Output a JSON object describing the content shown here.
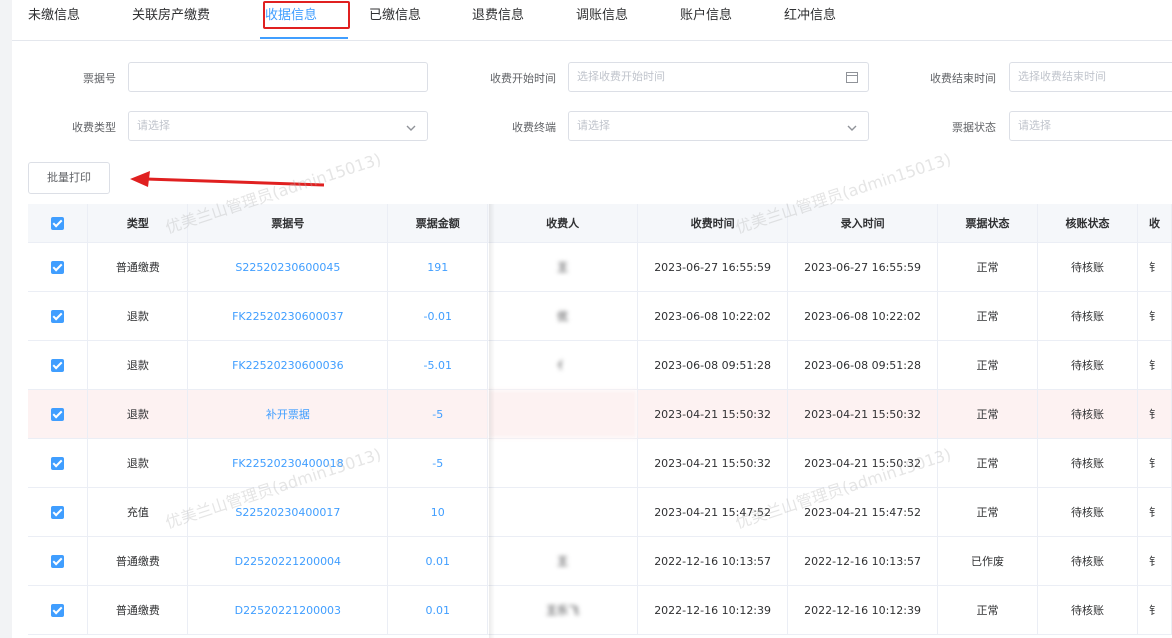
{
  "tabs": [
    {
      "label": "未缴信息"
    },
    {
      "label": "关联房产缴费"
    },
    {
      "label": "收据信息"
    },
    {
      "label": "已缴信息"
    },
    {
      "label": "退费信息"
    },
    {
      "label": "调账信息"
    },
    {
      "label": "账户信息"
    },
    {
      "label": "红冲信息"
    }
  ],
  "active_tab": "收据信息",
  "filters": {
    "receipt_no": {
      "label": "票据号",
      "value": "",
      "placeholder": ""
    },
    "start_time": {
      "label": "收费开始时间",
      "placeholder": "选择收费开始时间"
    },
    "end_time": {
      "label": "收费结束时间",
      "placeholder": "选择收费结束时间"
    },
    "fee_type": {
      "label": "收费类型",
      "placeholder": "请选择"
    },
    "terminal": {
      "label": "收费终端",
      "placeholder": "请选择"
    },
    "receipt_status": {
      "label": "票据状态",
      "placeholder": "请选择"
    }
  },
  "batch_print_label": "批量打印",
  "watermark": "优美兰山管理员(admin15013)",
  "table": {
    "columns": [
      "类型",
      "票据号",
      "票据金额",
      "收费人",
      "收费时间",
      "录入时间",
      "票据状态",
      "核账状态",
      "收"
    ],
    "rows": [
      {
        "type": "普通缴费",
        "no": "S22520230600045",
        "amount": "191",
        "payer": "王",
        "charge_time": "2023-06-27 16:55:59",
        "entry_time": "2023-06-27 16:55:59",
        "status": "正常",
        "check": "待核账",
        "extra": "钅"
      },
      {
        "type": "退款",
        "no": "FK22520230600037",
        "amount": "-0.01",
        "payer": "优",
        "charge_time": "2023-06-08 10:22:02",
        "entry_time": "2023-06-08 10:22:02",
        "status": "正常",
        "check": "待核账",
        "extra": "钅"
      },
      {
        "type": "退款",
        "no": "FK22520230600036",
        "amount": "-5.01",
        "payer": "亻",
        "charge_time": "2023-06-08 09:51:28",
        "entry_time": "2023-06-08 09:51:28",
        "status": "正常",
        "check": "待核账",
        "extra": "钅"
      },
      {
        "type": "退款",
        "no": "补开票据",
        "amount": "-5",
        "payer": "",
        "charge_time": "2023-04-21 15:50:32",
        "entry_time": "2023-04-21 15:50:32",
        "status": "正常",
        "check": "待核账",
        "extra": "钅"
      },
      {
        "type": "退款",
        "no": "FK22520230400018",
        "amount": "-5",
        "payer": "",
        "charge_time": "2023-04-21 15:50:32",
        "entry_time": "2023-04-21 15:50:32",
        "status": "正常",
        "check": "待核账",
        "extra": "钅"
      },
      {
        "type": "充值",
        "no": "S22520230400017",
        "amount": "10",
        "payer": "",
        "charge_time": "2023-04-21 15:47:52",
        "entry_time": "2023-04-21 15:47:52",
        "status": "正常",
        "check": "待核账",
        "extra": "钅"
      },
      {
        "type": "普通缴费",
        "no": "D22520221200004",
        "amount": "0.01",
        "payer": "王",
        "charge_time": "2022-12-16 10:13:57",
        "entry_time": "2022-12-16 10:13:57",
        "status": "已作废",
        "check": "待核账",
        "extra": "钅"
      },
      {
        "type": "普通缴费",
        "no": "D22520221200003",
        "amount": "0.01",
        "payer": "王乐飞",
        "charge_time": "2022-12-16 10:12:39",
        "entry_time": "2022-12-16 10:12:39",
        "status": "正常",
        "check": "待核账",
        "extra": "钅"
      }
    ]
  },
  "colors": {
    "accent": "#409eff",
    "highlight_border": "#e02020",
    "arrow": "#e02020"
  }
}
